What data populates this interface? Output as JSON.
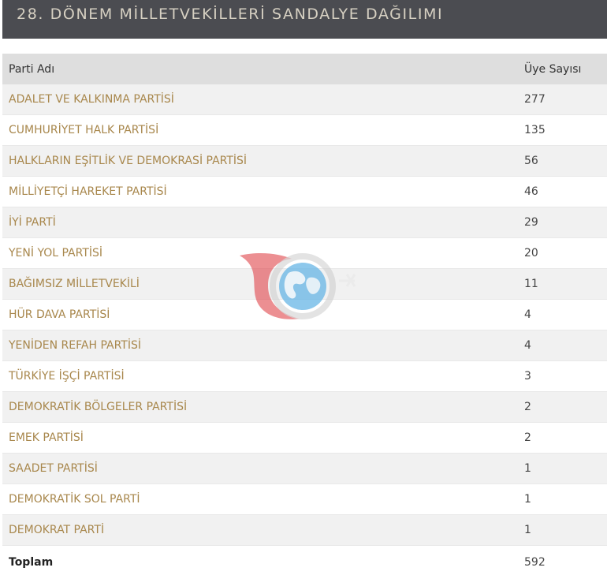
{
  "header": {
    "title": "28. DÖNEM MİLLETVEKİLLERİ SANDALYE DAĞILIMI"
  },
  "table": {
    "columns": {
      "party": "Parti Adı",
      "members": "Üye Sayısı"
    },
    "rows": [
      {
        "party": "ADALET VE KALKINMA PARTİSİ",
        "members": "277"
      },
      {
        "party": "CUMHURİYET HALK PARTİSİ",
        "members": "135"
      },
      {
        "party": "HALKLARIN EŞİTLİK VE DEMOKRASİ PARTİSİ",
        "members": "56"
      },
      {
        "party": "MİLLİYETÇİ HAREKET PARTİSİ",
        "members": "46"
      },
      {
        "party": "İYİ PARTİ",
        "members": "29"
      },
      {
        "party": "YENİ YOL PARTİSİ",
        "members": "20"
      },
      {
        "party": "BAĞIMSIZ MİLLETVEKİLİ",
        "members": "11"
      },
      {
        "party": "HÜR DAVA PARTİSİ",
        "members": "4"
      },
      {
        "party": "YENİDEN REFAH PARTİSİ",
        "members": "4"
      },
      {
        "party": "TÜRKİYE İŞÇİ PARTİSİ",
        "members": "3"
      },
      {
        "party": "DEMOKRATİK BÖLGELER PARTİSİ",
        "members": "2"
      },
      {
        "party": "EMEK PARTİSİ",
        "members": "2"
      },
      {
        "party": "SAADET PARTİSİ",
        "members": "1"
      },
      {
        "party": "DEMOKRATİK SOL PARTİ",
        "members": "1"
      },
      {
        "party": "DEMOKRAT PARTİ",
        "members": "1"
      }
    ],
    "total": {
      "label": "Toplam",
      "members": "592"
    }
  },
  "colors": {
    "header_bg": "#4b4c51",
    "header_text": "#d6d0c2",
    "party_link": "#a8874c",
    "row_stripe": "#f1f1f1",
    "thead_bg": "#dedede"
  },
  "icons": {
    "watermark": "globe-logo-icon"
  }
}
